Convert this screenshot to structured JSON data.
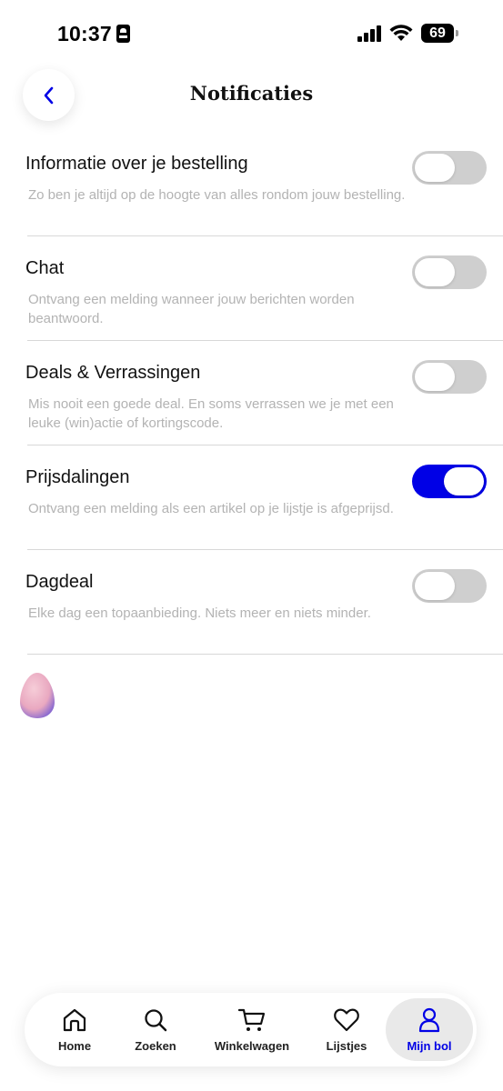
{
  "status_bar": {
    "time": "10:37",
    "battery": "69"
  },
  "header": {
    "title": "Notificaties"
  },
  "settings": [
    {
      "title": "Informatie over je bestelling",
      "description": "Zo ben je altijd op de hoogte van alles rondom jouw bestelling.",
      "enabled": false
    },
    {
      "title": "Chat",
      "description": "Ontvang een melding wanneer jouw berichten worden beantwoord.",
      "enabled": false
    },
    {
      "title": "Deals & Verrassingen",
      "description": "Mis nooit een goede deal. En soms verrassen we je met een leuke (win)actie of kortingscode.",
      "enabled": false
    },
    {
      "title": "Prijsdalingen",
      "description": "Ontvang een melding als een artikel op je lijstje is afgeprijsd.",
      "enabled": true
    },
    {
      "title": "Dagdeal",
      "description": "Elke dag een topaanbieding. Niets meer en niets minder.",
      "enabled": false
    }
  ],
  "bottom_nav": {
    "items": [
      {
        "label": "Home",
        "icon": "home-icon"
      },
      {
        "label": "Zoeken",
        "icon": "search-icon"
      },
      {
        "label": "Winkelwagen",
        "icon": "cart-icon"
      },
      {
        "label": "Lijstjes",
        "icon": "heart-icon"
      },
      {
        "label": "Mijn bol",
        "icon": "user-icon",
        "active": true
      }
    ]
  },
  "colors": {
    "accent": "#0000e6",
    "toggle_off": "#cfcfcf",
    "description_text": "#b3b3b3"
  }
}
